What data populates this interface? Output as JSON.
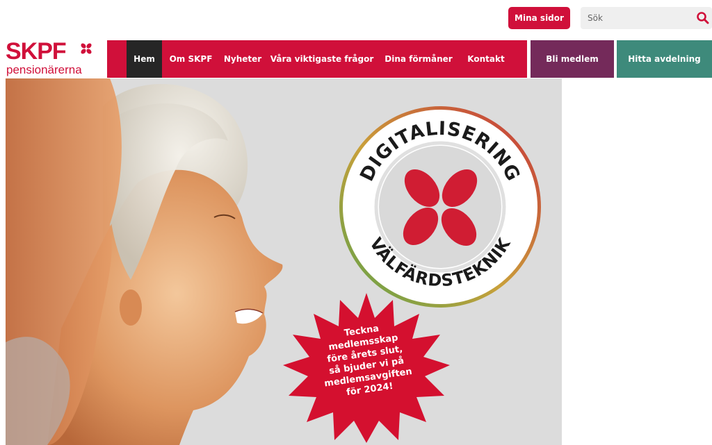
{
  "header": {
    "mina_sidor": "Mina sidor",
    "search_placeholder": "Sök",
    "search_icon": "search-icon"
  },
  "logo": {
    "main": "SKPF",
    "sub": "pensionärerna"
  },
  "nav": {
    "items": [
      "Hem",
      "Om SKPF",
      "Nyheter",
      "Våra viktigaste frågor",
      "Dina förmåner",
      "Kontakt"
    ],
    "active": "Hem",
    "bli_medlem": "Bli medlem",
    "hitta_avdelning": "Hitta avdelning"
  },
  "hero": {
    "badge_top": "DIGITALISERING",
    "badge_bottom": "VÄLFÄRDSTEKNIK",
    "promo_lines": [
      "Teckna",
      "medlemsskap",
      "före årets slut,",
      "så bjuder vi på",
      "medlemsavgiften",
      "för 2024!"
    ]
  },
  "colors": {
    "brand_red": "#d0103a",
    "nav_active": "#262626",
    "bli_medlem": "#742a5a",
    "hitta_avdelning": "#3e8a7b",
    "hero_bg": "#dcdcdc"
  }
}
